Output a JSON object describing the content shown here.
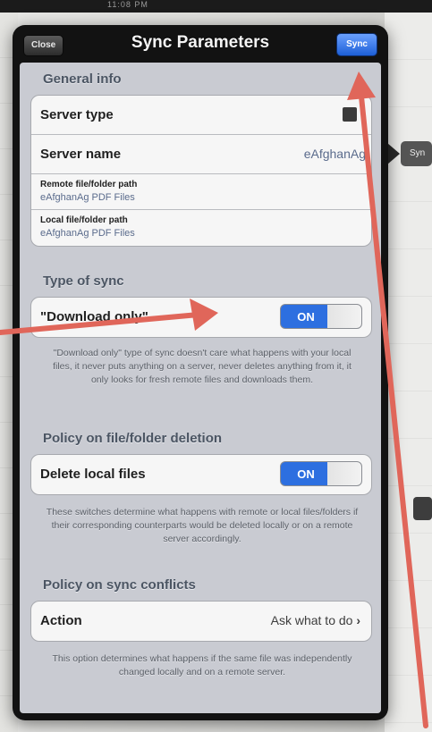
{
  "window": {
    "title": "Sync Parameters",
    "close_label": "Close",
    "sync_label": "Sync"
  },
  "background": {
    "status_text": "11:08 PM",
    "sync_button": "Syn"
  },
  "sections": {
    "general": {
      "header": "General info",
      "server_type": {
        "label": "Server type",
        "value": ""
      },
      "server_name": {
        "label": "Server name",
        "value": "eAfghanAg"
      },
      "remote_path": {
        "label": "Remote file/folder path",
        "value": "eAfghanAg PDF Files"
      },
      "local_path": {
        "label": "Local file/folder path",
        "value": "eAfghanAg PDF Files"
      }
    },
    "sync_type": {
      "header": "Type of sync",
      "row": {
        "label": "\"Download only\"",
        "toggle": "ON"
      },
      "footnote": "\"Download only\" type of sync doesn't care what happens with your local files, it never puts anything on a server, never deletes anything from it, it only looks for fresh remote files and downloads them."
    },
    "deletion": {
      "header": "Policy on file/folder deletion",
      "row": {
        "label": "Delete local files",
        "toggle": "ON"
      },
      "footnote": "These switches determine what happens with remote or local files/folders if their corresponding counterparts would be deleted locally or on a remote server accordingly."
    },
    "conflicts": {
      "header": "Policy on sync conflicts",
      "row": {
        "label": "Action",
        "value": "Ask what to do",
        "chevron": "›"
      },
      "footnote": "This option determines what happens if the same file was independently changed locally and on a remote server."
    }
  },
  "colors": {
    "accent": "#2d6fe0",
    "annotation": "#e0665a"
  }
}
